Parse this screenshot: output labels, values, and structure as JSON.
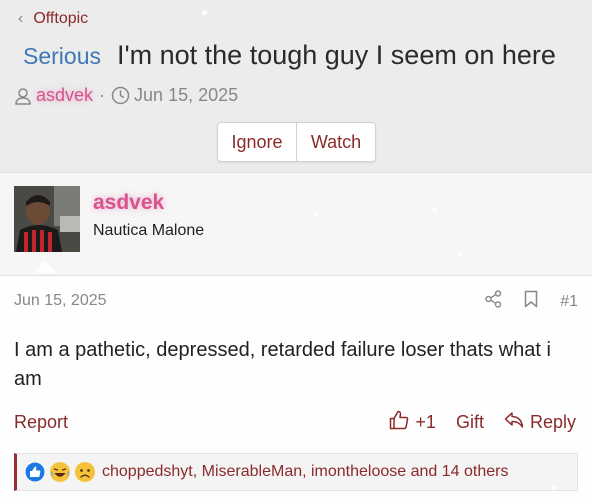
{
  "breadcrumb": {
    "label": "Offtopic"
  },
  "thread": {
    "prefix": "Serious",
    "title": "I'm not the tough guy I seem on here",
    "author": "asdvek",
    "separator": "·",
    "date": "Jun 15, 2025"
  },
  "thread_buttons": {
    "ignore": "Ignore",
    "watch": "Watch"
  },
  "post": {
    "username": "asdvek",
    "user_title": "Nautica Malone",
    "date": "Jun 15, 2025",
    "number": "#1",
    "body": "I am a pathetic, depressed, retarded failure loser thats what i am",
    "report": "Report",
    "like_count": "+1",
    "gift": "Gift",
    "reply": "Reply"
  },
  "reactions": {
    "text": "choppedshyt, MiserableMan, imontheloose and 14 others",
    "icons": [
      "like-icon",
      "laugh-icon",
      "sad-icon"
    ]
  },
  "colors": {
    "link": "#8a2a2a",
    "prefix": "#3f78b5",
    "username": "#d6538e",
    "header_bg": "#ececec"
  }
}
